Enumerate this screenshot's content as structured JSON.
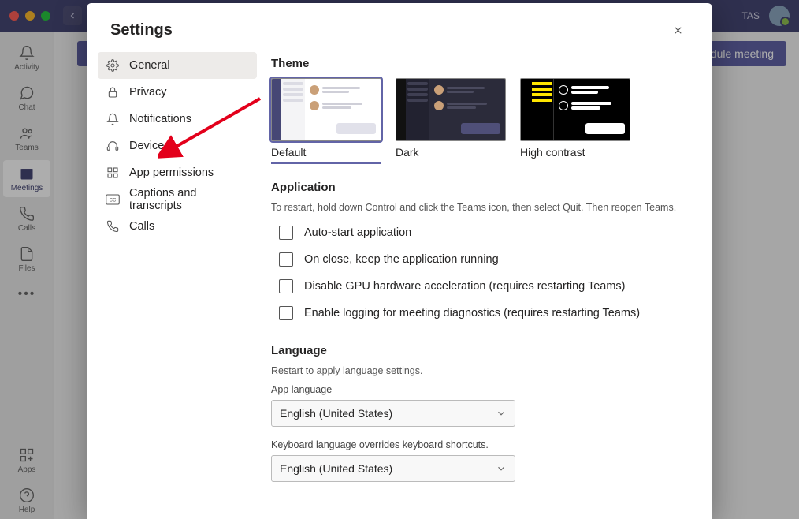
{
  "titlebar": {
    "user_initials": "TAS"
  },
  "leftnav": {
    "items": [
      {
        "label": "Activity"
      },
      {
        "label": "Chat"
      },
      {
        "label": "Teams"
      },
      {
        "label": "Meetings"
      },
      {
        "label": "Calls"
      },
      {
        "label": "Files"
      }
    ],
    "more": "•••",
    "apps": "Apps",
    "help": "Help"
  },
  "behind": {
    "schedule_button": "dule meeting"
  },
  "modal": {
    "title": "Settings",
    "sidebar": [
      {
        "label": "General"
      },
      {
        "label": "Privacy"
      },
      {
        "label": "Notifications"
      },
      {
        "label": "Devices"
      },
      {
        "label": "App permissions"
      },
      {
        "label": "Captions and transcripts"
      },
      {
        "label": "Calls"
      }
    ],
    "theme": {
      "heading": "Theme",
      "options": [
        {
          "label": "Default"
        },
        {
          "label": "Dark"
        },
        {
          "label": "High contrast"
        }
      ]
    },
    "application": {
      "heading": "Application",
      "note": "To restart, hold down Control and click the Teams icon, then select Quit. Then reopen Teams.",
      "checks": [
        "Auto-start application",
        "On close, keep the application running",
        "Disable GPU hardware acceleration (requires restarting Teams)",
        "Enable logging for meeting diagnostics (requires restarting Teams)"
      ]
    },
    "language": {
      "heading": "Language",
      "note": "Restart to apply language settings.",
      "app_lang_label": "App language",
      "app_lang_value": "English (United States)",
      "kb_note": "Keyboard language overrides keyboard shortcuts.",
      "kb_value": "English (United States)"
    }
  }
}
